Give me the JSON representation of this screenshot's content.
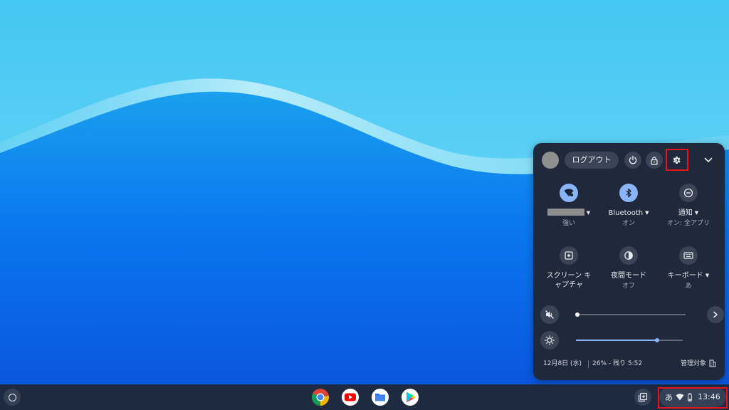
{
  "quick_settings": {
    "logout_label": "ログアウト",
    "tiles": {
      "network": {
        "sub": "強い"
      },
      "bluetooth": {
        "label": "Bluetooth",
        "sub": "オン"
      },
      "notifications": {
        "label": "通知",
        "sub": "オン: 全アプリ"
      },
      "screen_capture": {
        "label": "スクリーン キャプチャ"
      },
      "night_light": {
        "label": "夜間モード",
        "sub": "オフ"
      },
      "keyboard": {
        "label": "キーボード",
        "sub": "あ"
      }
    },
    "sliders": {
      "volume": {
        "level": 0,
        "muted": true
      },
      "brightness": {
        "level": 0.76
      }
    },
    "footer": {
      "date": "12月8日 (水)",
      "battery": "26% - 残り 5:52",
      "managed": "管理対象"
    }
  },
  "tray": {
    "ime": "あ",
    "clock": "13:46"
  },
  "icons": {
    "launcher": "launcher-circle-icon",
    "apps": [
      "chrome-icon",
      "youtube-icon",
      "files-icon",
      "play-store-icon"
    ],
    "tote": "tote-icon"
  },
  "colors": {
    "accent": "#8ab4f8",
    "panel_bg": "#20293b",
    "highlight_border": "#e3151f"
  }
}
